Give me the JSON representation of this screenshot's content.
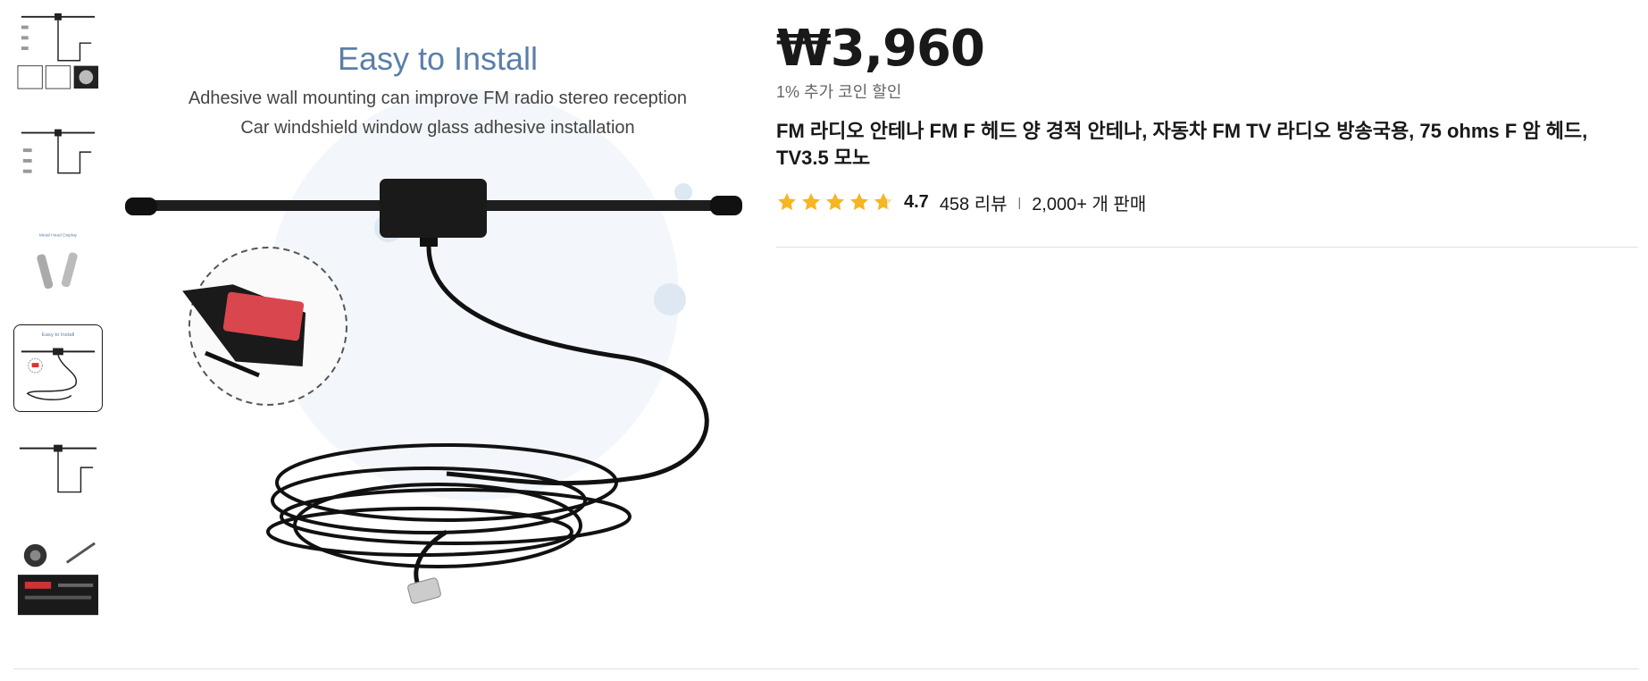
{
  "product": {
    "price": "₩3,960",
    "coin_discount": "1% 추가 코인 할인",
    "title": "FM 라디오 안테나 FM F 헤드 양 경적 안테나, 자동차 FM TV 라디오 방송국용, 75 ohms F 암 헤드, TV3.5 모노",
    "rating": "4.7",
    "reviews": "458 리뷰",
    "separator": "|",
    "sold": "2,000+ 개 판매"
  },
  "main_image": {
    "heading": "Easy to Install",
    "line1": "Adhesive wall mounting can improve FM radio stereo reception",
    "line2": "Car windshield window glass adhesive installation"
  },
  "thumbnails": {
    "count": 6,
    "active_index": 3,
    "thumb3_line": "Metal Head Display",
    "thumb4_line": "Easy to Install"
  },
  "colors": {
    "star": "#f5b623",
    "price": "#191919",
    "heading_blue": "#5b7fa8"
  }
}
